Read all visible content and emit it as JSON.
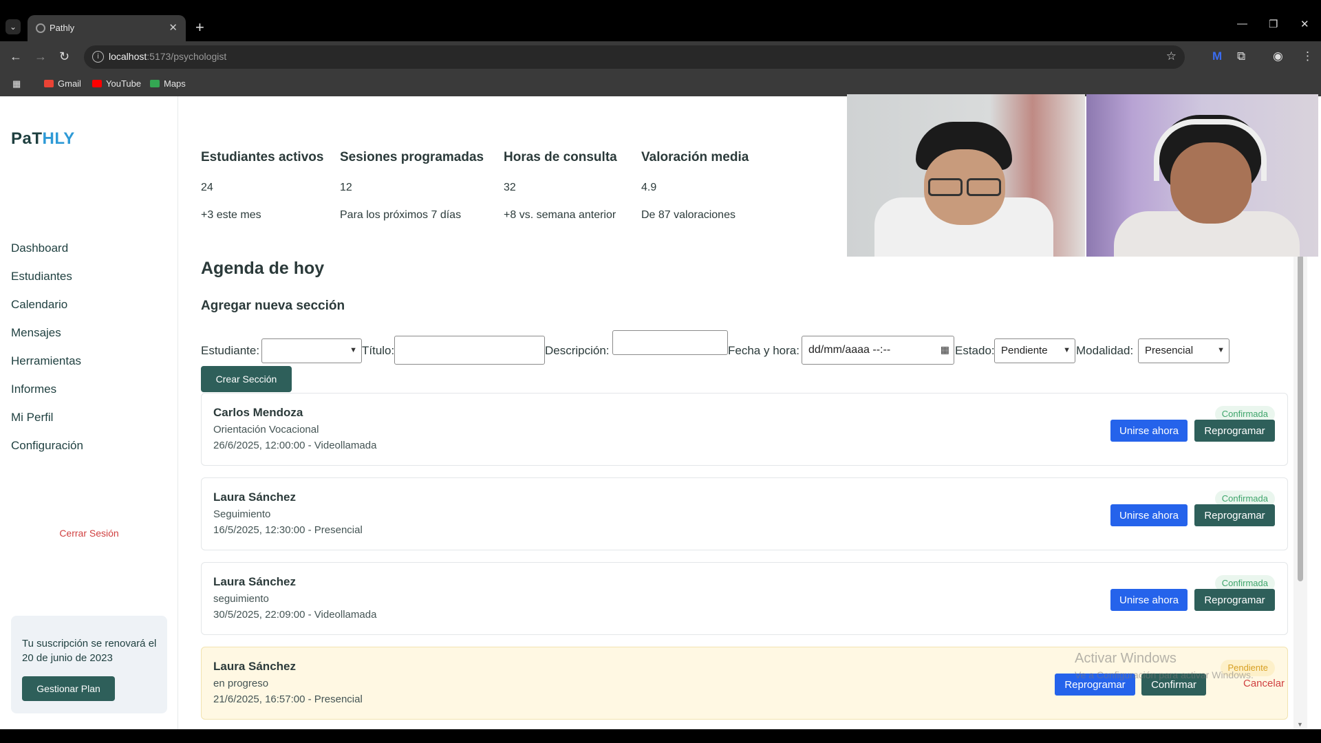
{
  "browser": {
    "tab_title": "Pathly",
    "url_host": "localhost",
    "url_path": ":5173/psychologist",
    "bookmarks": [
      {
        "label": "Gmail",
        "color": "#ea4335"
      },
      {
        "label": "YouTube",
        "color": "#ff0000"
      },
      {
        "label": "Maps",
        "color": "#34a853"
      }
    ]
  },
  "sidebar": {
    "logo_part1": "PaT",
    "logo_part2": "HLY",
    "items": [
      {
        "label": "Dashboard"
      },
      {
        "label": "Estudiantes"
      },
      {
        "label": "Calendario"
      },
      {
        "label": "Mensajes"
      },
      {
        "label": "Herramientas"
      },
      {
        "label": "Informes"
      },
      {
        "label": "Mi Perfil"
      },
      {
        "label": "Configuración"
      }
    ],
    "logout": "Cerrar Sesión",
    "subscription_text": "Tu suscripción se renovará el 20 de junio de 2023",
    "manage_plan": "Gestionar Plan"
  },
  "stats": [
    {
      "label": "Estudiantes activos",
      "value": "24",
      "sub": "+3 este mes"
    },
    {
      "label": "Sesiones programadas",
      "value": "12",
      "sub": "Para los próximos 7 días"
    },
    {
      "label": "Horas de consulta",
      "value": "32",
      "sub": "+8 vs. semana anterior"
    },
    {
      "label": "Valoración media",
      "value": "4.9",
      "sub": "De 87 valoraciones"
    }
  ],
  "agenda_title": "Agenda de hoy",
  "form": {
    "title": "Agregar nueva sección",
    "student_label": "Estudiante:",
    "student_value": "",
    "title_label": "Título:",
    "title_value": "",
    "description_label": "Descripción:",
    "datetime_label": "Fecha y hora:",
    "datetime_placeholder": "dd/mm/aaaa --:--",
    "status_label": "Estado:",
    "status_value": "Pendiente",
    "mode_label": "Modalidad:",
    "mode_value": "Presencial",
    "submit": "Crear Sección"
  },
  "sessions": [
    {
      "name": "Carlos Mendoza",
      "topic": "Orientación Vocacional",
      "when": "26/6/2025, 12:00:00 - Videollamada",
      "status": "Confirmada",
      "join": "Unirse ahora",
      "reschedule": "Reprogramar"
    },
    {
      "name": "Laura Sánchez",
      "topic": "Seguimiento",
      "when": "16/5/2025, 12:30:00 - Presencial",
      "status": "Confirmada",
      "join": "Unirse ahora",
      "reschedule": "Reprogramar"
    },
    {
      "name": "Laura Sánchez",
      "topic": "seguimiento",
      "when": "30/5/2025, 22:09:00 - Videollamada",
      "status": "Confirmada",
      "join": "Unirse ahora",
      "reschedule": "Reprogramar"
    },
    {
      "name": "Laura Sánchez",
      "topic": "en progreso",
      "when": "21/6/2025, 16:57:00 - Presencial",
      "status": "Pendiente",
      "reschedule": "Reprogramar",
      "confirm": "Confirmar",
      "cancel": "Cancelar"
    }
  ],
  "watermark": {
    "line1": "Activar Windows",
    "line2": "Ve a Configuración para activar Windows."
  },
  "colors": {
    "accent_dark": "#2e5f5a",
    "accent_blue": "#2563eb",
    "logo_blue": "#2e9ad6",
    "danger": "#d04040"
  }
}
